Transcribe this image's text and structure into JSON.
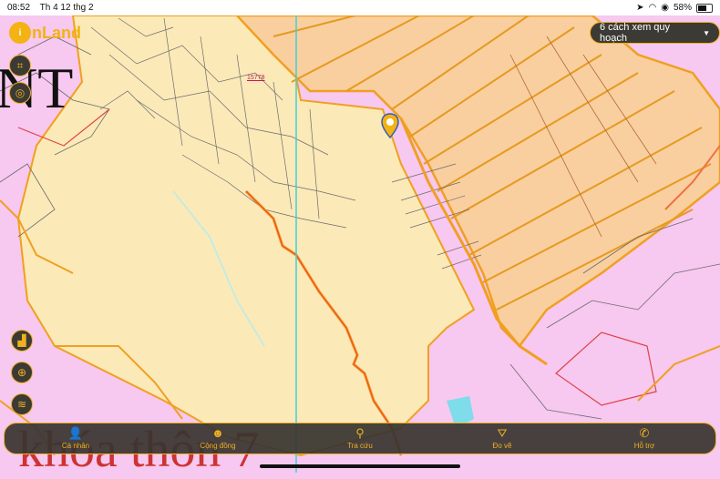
{
  "status": {
    "time": "08:52",
    "date": "Th 4 12 thg 2",
    "battery": "58%"
  },
  "app": {
    "logo_mark": "i",
    "logo_text": "nLand"
  },
  "plan_button": {
    "label": "6 cách xem quy hoạch",
    "icon": "caret-down-icon"
  },
  "map": {
    "overlay_text_1": "NT",
    "overlay_text_2": "khóa thôn 7",
    "plot_label": "15778"
  },
  "tools": [
    {
      "name": "measure-tool-icon",
      "glyph": "⌗"
    },
    {
      "name": "location-pin-tool-icon",
      "glyph": "◎"
    },
    {
      "name": "chart-tool-icon",
      "glyph": "▟"
    },
    {
      "name": "crosshair-icon",
      "glyph": "⊕"
    },
    {
      "name": "layers-icon",
      "glyph": "≋"
    }
  ],
  "nav": [
    {
      "label": "Cá nhân",
      "icon": "user-icon",
      "glyph": "👤"
    },
    {
      "label": "Cộng đồng",
      "icon": "community-icon",
      "glyph": "☻"
    },
    {
      "label": "Tra cứu",
      "icon": "search-icon",
      "glyph": "⚲"
    },
    {
      "label": "Đo vẽ",
      "icon": "draw-icon",
      "glyph": "⛛"
    },
    {
      "label": "Hỗ trợ",
      "icon": "phone-icon",
      "glyph": "✆"
    }
  ],
  "colors": {
    "residential": "#f7c8f0",
    "agricultural": "#fbe9b8",
    "industrial": "#f9cfa0",
    "boundary": "#f0a020",
    "accent": "#f0b020"
  }
}
